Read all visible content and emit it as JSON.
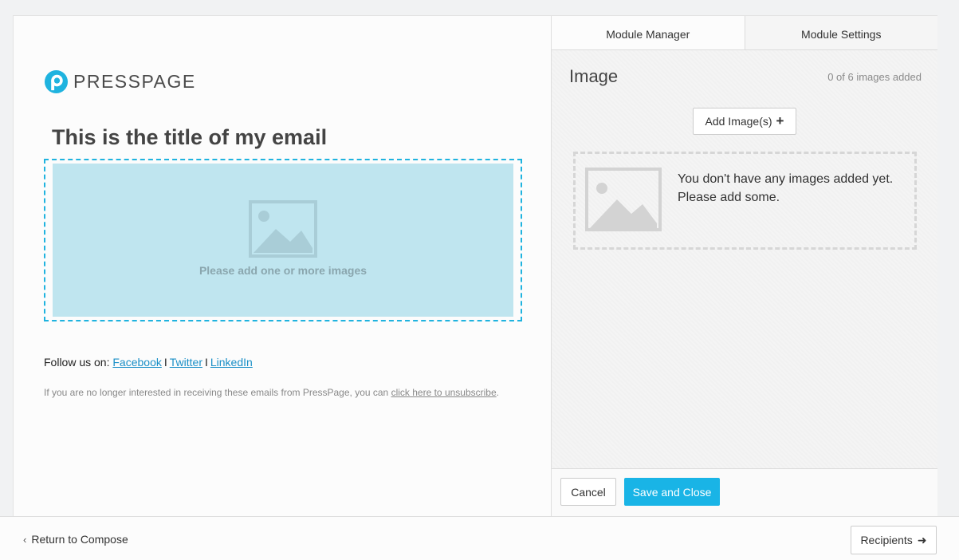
{
  "brand": {
    "name": "PRESSPAGE",
    "accent": "#1fb3df",
    "primary_button": "#19b4e6"
  },
  "email": {
    "title": "This is the title of my email",
    "image_placeholder": "Please add one or more images",
    "follow": {
      "prefix": "Follow us on:",
      "links": [
        "Facebook",
        "Twitter",
        "LinkedIn"
      ],
      "separator": "I"
    },
    "unsubscribe": {
      "text": "If you are no longer interested in receiving these emails from PressPage, you can",
      "link": "click here to unsubscribe",
      "suffix": "."
    }
  },
  "panel": {
    "tabs": [
      {
        "label": "Module Manager",
        "active": true
      },
      {
        "label": "Module Settings",
        "active": false
      }
    ],
    "title": "Image",
    "count_text": "0 of 6 images added",
    "add_button": "Add Image(s)",
    "add_icon": "plus-icon",
    "empty_line1": "You don't have any images added yet.",
    "empty_line2": "Please add some.",
    "cancel": "Cancel",
    "save": "Save and Close"
  },
  "footer": {
    "back_label": "Return to Compose",
    "back_icon": "chevron-left-icon",
    "next_label": "Recipients",
    "next_icon": "arrow-right-icon"
  }
}
